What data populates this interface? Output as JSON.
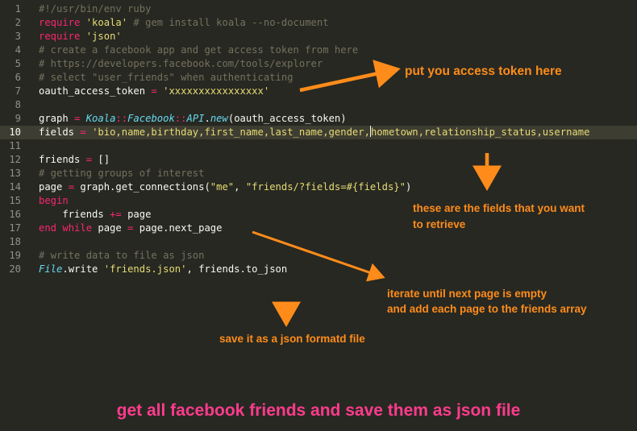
{
  "editor": {
    "current_line": 10,
    "lines": [
      {
        "n": "1",
        "segs": [
          {
            "c": "com",
            "t": "#!/usr/bin/env ruby"
          }
        ]
      },
      {
        "n": "2",
        "segs": [
          {
            "c": "kw",
            "t": "require"
          },
          {
            "c": "",
            "t": " "
          },
          {
            "c": "str",
            "t": "'koala'"
          },
          {
            "c": "com",
            "t": " # gem install koala --no-document"
          }
        ]
      },
      {
        "n": "3",
        "segs": [
          {
            "c": "kw",
            "t": "require"
          },
          {
            "c": "",
            "t": " "
          },
          {
            "c": "str",
            "t": "'json'"
          }
        ]
      },
      {
        "n": "4",
        "segs": [
          {
            "c": "com",
            "t": "# create a facebook app and get access token from here"
          }
        ]
      },
      {
        "n": "5",
        "segs": [
          {
            "c": "com",
            "t": "# https://developers.facebook.com/tools/explorer"
          }
        ]
      },
      {
        "n": "6",
        "segs": [
          {
            "c": "com",
            "t": "# select \"user_friends\" when authenticating"
          }
        ]
      },
      {
        "n": "7",
        "segs": [
          {
            "c": "",
            "t": "oauth_access_token "
          },
          {
            "c": "kw",
            "t": "="
          },
          {
            "c": "",
            "t": " "
          },
          {
            "c": "str",
            "t": "'xxxxxxxxxxxxxxxx'"
          }
        ]
      },
      {
        "n": "8",
        "segs": []
      },
      {
        "n": "9",
        "segs": [
          {
            "c": "",
            "t": "graph "
          },
          {
            "c": "kw",
            "t": "="
          },
          {
            "c": "",
            "t": " "
          },
          {
            "c": "cls",
            "t": "Koala"
          },
          {
            "c": "kw",
            "t": "::"
          },
          {
            "c": "cls",
            "t": "Facebook"
          },
          {
            "c": "kw",
            "t": "::"
          },
          {
            "c": "cls",
            "t": "API"
          },
          {
            "c": "",
            "t": "."
          },
          {
            "c": "fn",
            "t": "new"
          },
          {
            "c": "",
            "t": "(oauth_access_token)"
          }
        ]
      },
      {
        "n": "10",
        "segs": [
          {
            "c": "",
            "t": "fields "
          },
          {
            "c": "kw",
            "t": "="
          },
          {
            "c": "",
            "t": " "
          },
          {
            "c": "str",
            "t": "'bio,name,birthday,first_name,last_name,gender,"
          },
          {
            "c": "caret",
            "t": ""
          },
          {
            "c": "str",
            "t": "hometown,relationship_status,username"
          }
        ]
      },
      {
        "n": "11",
        "segs": []
      },
      {
        "n": "12",
        "segs": [
          {
            "c": "",
            "t": "friends "
          },
          {
            "c": "kw",
            "t": "="
          },
          {
            "c": "",
            "t": " []"
          }
        ]
      },
      {
        "n": "13",
        "segs": [
          {
            "c": "com",
            "t": "# getting groups of interest"
          }
        ]
      },
      {
        "n": "14",
        "segs": [
          {
            "c": "",
            "t": "page "
          },
          {
            "c": "kw",
            "t": "="
          },
          {
            "c": "",
            "t": " graph.get_connections("
          },
          {
            "c": "str",
            "t": "\"me\""
          },
          {
            "c": "",
            "t": ", "
          },
          {
            "c": "str",
            "t": "\"friends/?fields=#{fields}\""
          },
          {
            "c": "",
            "t": ")"
          }
        ]
      },
      {
        "n": "15",
        "segs": [
          {
            "c": "kw",
            "t": "begin"
          }
        ]
      },
      {
        "n": "16",
        "segs": [
          {
            "c": "",
            "t": "    friends "
          },
          {
            "c": "kw",
            "t": "+="
          },
          {
            "c": "",
            "t": " page"
          }
        ]
      },
      {
        "n": "17",
        "segs": [
          {
            "c": "kw",
            "t": "end"
          },
          {
            "c": "",
            "t": " "
          },
          {
            "c": "kw",
            "t": "while"
          },
          {
            "c": "",
            "t": " page "
          },
          {
            "c": "kw",
            "t": "="
          },
          {
            "c": "",
            "t": " page.next_page"
          }
        ]
      },
      {
        "n": "18",
        "segs": []
      },
      {
        "n": "19",
        "segs": [
          {
            "c": "com",
            "t": "# write data to file as json"
          }
        ]
      },
      {
        "n": "20",
        "segs": [
          {
            "c": "cls",
            "t": "File"
          },
          {
            "c": "",
            "t": ".write "
          },
          {
            "c": "str",
            "t": "'friends.json'"
          },
          {
            "c": "",
            "t": ", friends.to_json"
          }
        ]
      }
    ]
  },
  "annotations": {
    "token": "put you access token here",
    "fields_1": "these are the fields that you want",
    "fields_2": "to retrieve",
    "iterate_1": "iterate until next page is empty",
    "iterate_2": "and add each page to the friends array",
    "save": "save it as a json formatd file"
  },
  "title": "get all facebook friends and save them as json file",
  "colors": {
    "background": "#272822",
    "annotation": "#ff8c1a",
    "title": "#ff3b8d",
    "keyword": "#f92672",
    "string": "#e6db74",
    "comment": "#75715e",
    "class": "#66d9ef"
  }
}
